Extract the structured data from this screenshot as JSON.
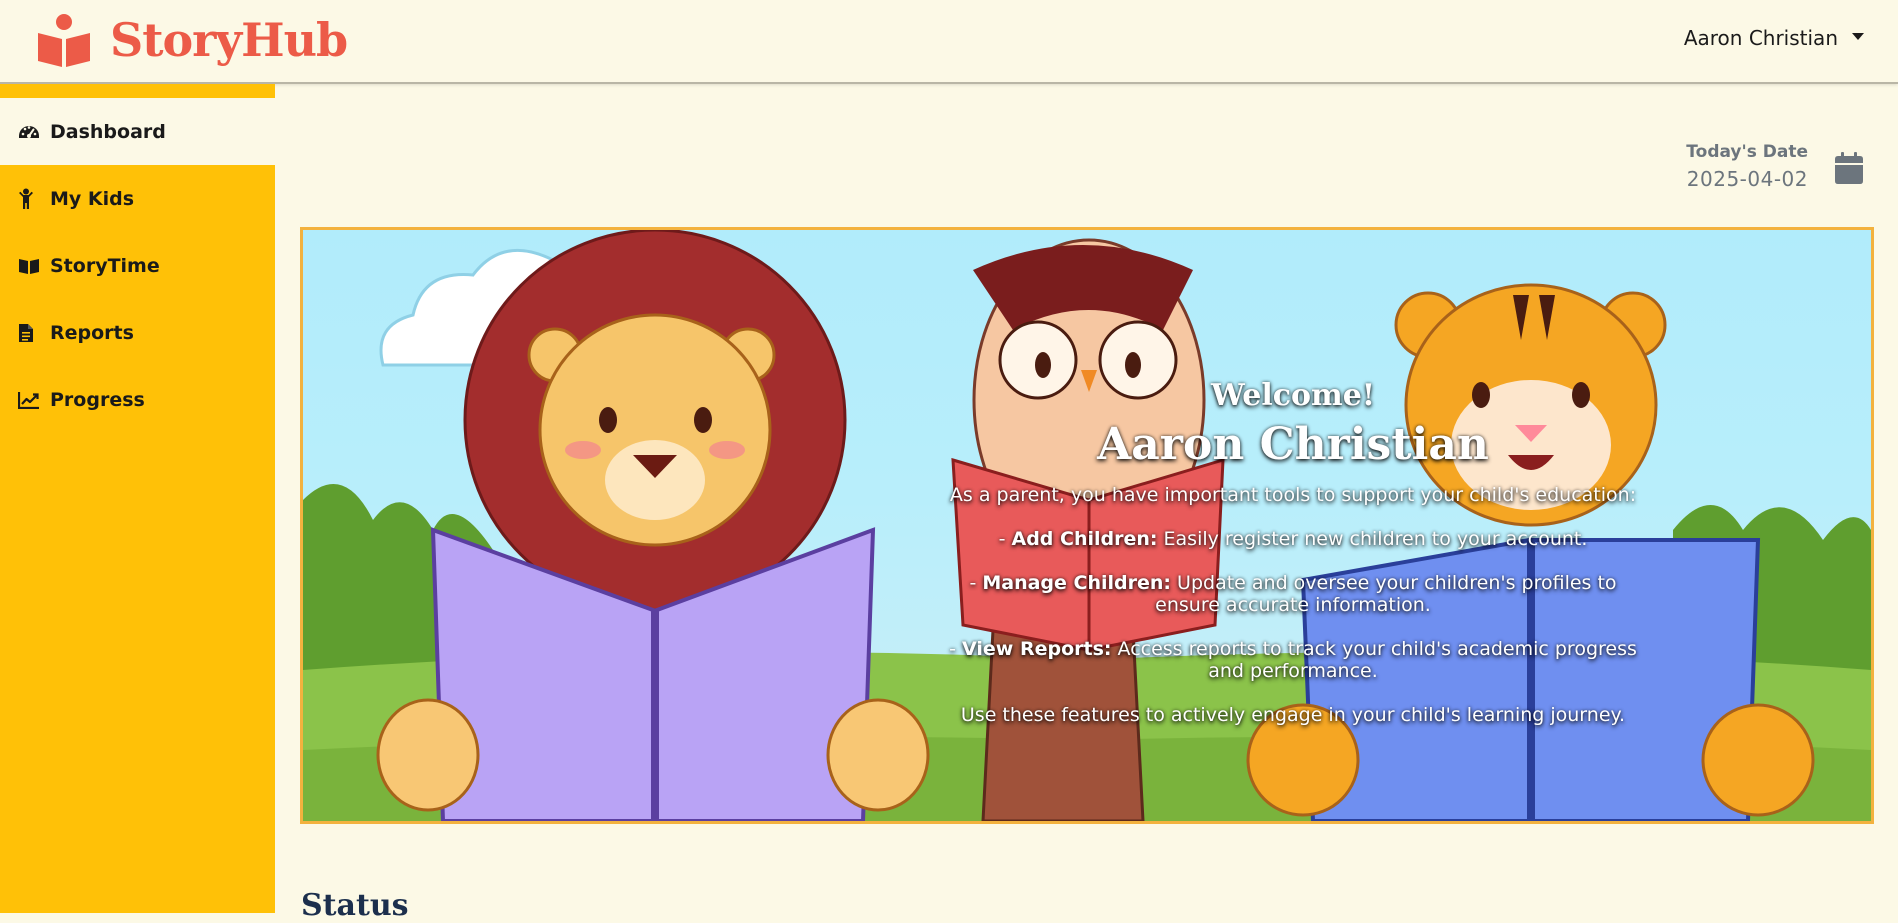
{
  "header": {
    "brand_name": "StoryHub",
    "user_name": "Aaron Christian"
  },
  "sidebar": {
    "items": [
      {
        "label": "Dashboard",
        "icon": "gauge-icon",
        "active": true
      },
      {
        "label": "My Kids",
        "icon": "child-icon",
        "active": false
      },
      {
        "label": "StoryTime",
        "icon": "book-open-icon",
        "active": false
      },
      {
        "label": "Reports",
        "icon": "file-icon",
        "active": false
      },
      {
        "label": "Progress",
        "icon": "chart-line-icon",
        "active": false
      }
    ]
  },
  "date": {
    "label": "Today's Date",
    "value": "2025-04-02"
  },
  "banner": {
    "welcome": "Welcome!",
    "name": "Aaron Christian",
    "description": "As a parent, you have important tools to support your child's education:",
    "features": [
      {
        "prefix": "- ",
        "title": "Add Children:",
        "text": " Easily register new children to your account."
      },
      {
        "prefix": "- ",
        "title": "Manage Children:",
        "text": " Update and oversee your children's profiles to ensure accurate information."
      },
      {
        "prefix": "- ",
        "title": "View Reports:",
        "text": " Access reports to track your child's academic progress and performance."
      }
    ],
    "closing": "Use these features to actively engage in your child's learning journey."
  },
  "section": {
    "title": "Status"
  },
  "colors": {
    "brand": "#ec5b48",
    "sidebar": "#ffc107",
    "background": "#fcf9e6",
    "banner_border": "#f3b23e"
  }
}
